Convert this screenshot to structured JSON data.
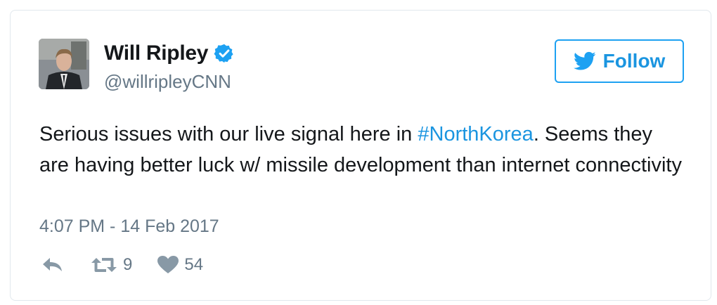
{
  "user": {
    "name": "Will Ripley",
    "handle": "@willripleyCNN",
    "verified_icon": "verified-badge-icon",
    "avatar_icon": "profile-photo"
  },
  "follow": {
    "label": "Follow",
    "icon": "twitter-bird-icon"
  },
  "tweet": {
    "text_before": "Serious issues with our live signal here in ",
    "hashtag": "#NorthKorea",
    "text_after": ". Seems they are having better luck w/ missile development than internet connectivity",
    "timestamp": "4:07 PM - 14 Feb 2017"
  },
  "actions": {
    "reply_icon": "reply-icon",
    "retweet_icon": "retweet-icon",
    "retweet_count": "9",
    "like_icon": "heart-icon",
    "like_count": "54"
  },
  "colors": {
    "accent": "#1da1f2",
    "link": "#1b95e0",
    "text": "#14171a",
    "secondary": "#657786",
    "border": "#e1e8ed"
  }
}
